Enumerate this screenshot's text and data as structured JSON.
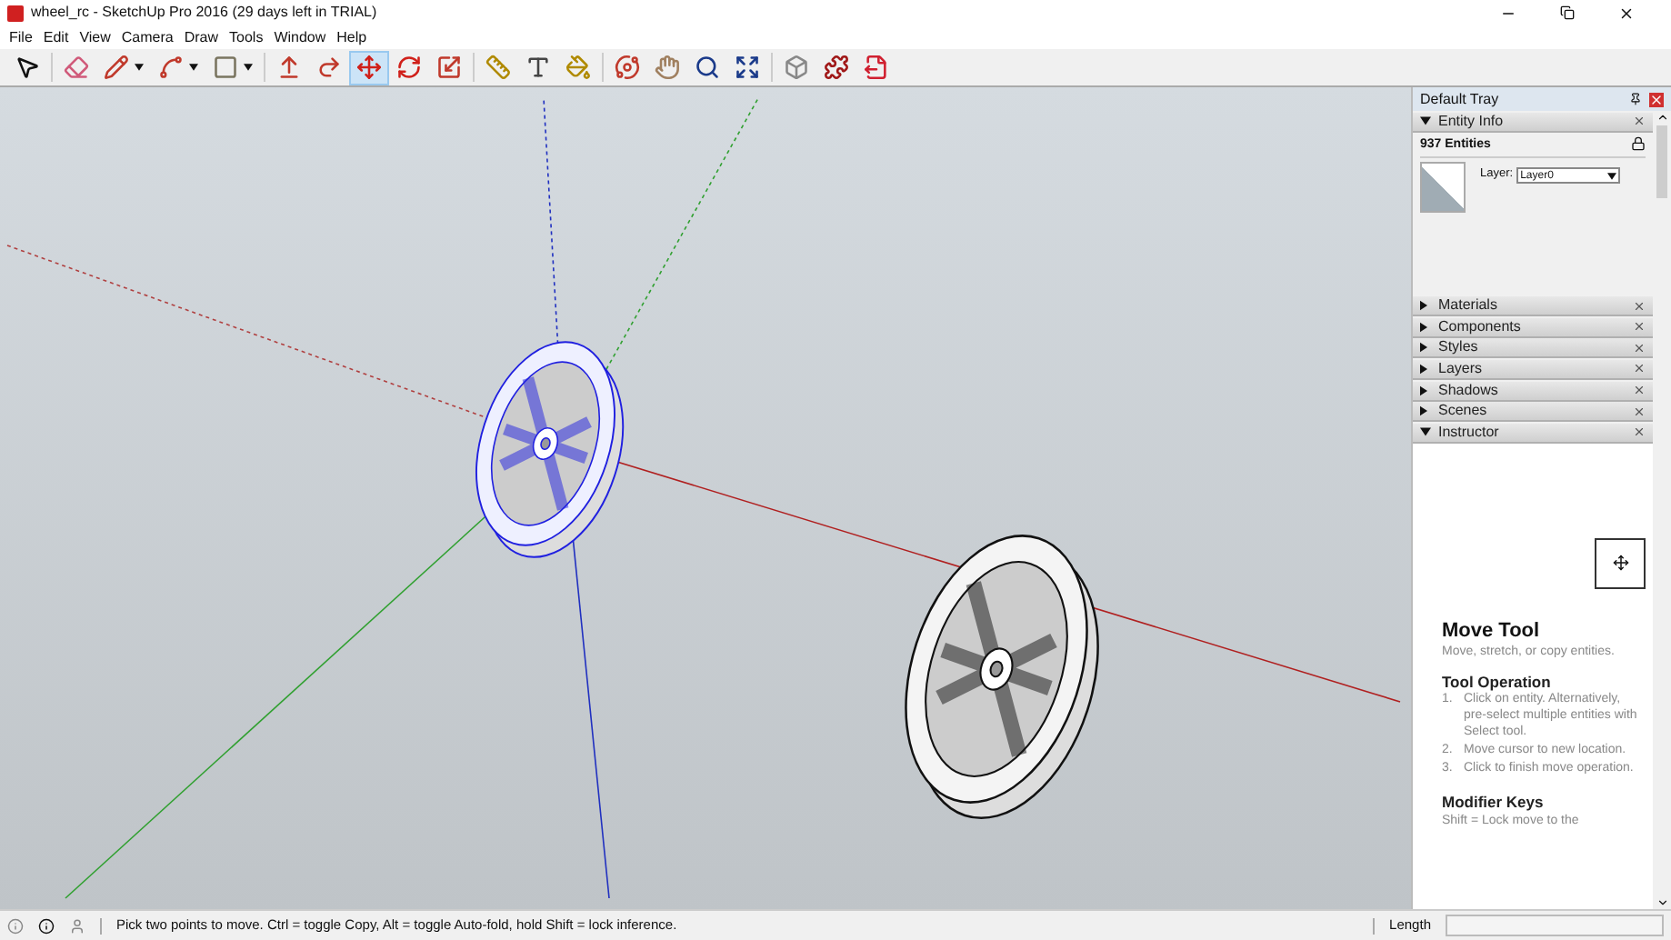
{
  "window": {
    "title": "wheel_rc - SketchUp Pro 2016 (29 days left in TRIAL)"
  },
  "menu": [
    "File",
    "Edit",
    "View",
    "Camera",
    "Draw",
    "Tools",
    "Window",
    "Help"
  ],
  "toolbar": [
    {
      "kind": "select",
      "selected": false
    },
    {
      "kind": "eraser",
      "selected": false
    },
    {
      "kind": "pencil",
      "selected": false,
      "dropdown": true
    },
    {
      "kind": "arc",
      "selected": false,
      "dropdown": true
    },
    {
      "kind": "rectangle",
      "selected": false,
      "dropdown": true
    },
    {
      "kind": "pushpull",
      "selected": false
    },
    {
      "kind": "followme",
      "selected": false
    },
    {
      "kind": "move",
      "selected": true
    },
    {
      "kind": "rotate",
      "selected": false
    },
    {
      "kind": "scale",
      "selected": false
    },
    {
      "kind": "tape",
      "selected": false
    },
    {
      "kind": "text",
      "selected": false
    },
    {
      "kind": "paint",
      "selected": false
    },
    {
      "kind": "orbit",
      "selected": false
    },
    {
      "kind": "pan",
      "selected": false
    },
    {
      "kind": "zoom",
      "selected": false
    },
    {
      "kind": "extents",
      "selected": false
    },
    {
      "kind": "warehouse",
      "selected": false
    },
    {
      "kind": "extension",
      "selected": false
    },
    {
      "kind": "export",
      "selected": false
    }
  ],
  "viewport": {
    "wheels": [
      {
        "selected": true
      },
      {
        "selected": false
      }
    ]
  },
  "tray": {
    "title": "Default Tray",
    "entity_info": {
      "title": "Entity Info",
      "expanded": true,
      "count": "937 Entities",
      "layer_label": "Layer:",
      "layer_value": "Layer0"
    },
    "panels": [
      {
        "title": "Materials",
        "expanded": false
      },
      {
        "title": "Components",
        "expanded": false
      },
      {
        "title": "Styles",
        "expanded": false
      },
      {
        "title": "Layers",
        "expanded": false
      },
      {
        "title": "Shadows",
        "expanded": false
      },
      {
        "title": "Scenes",
        "expanded": false
      },
      {
        "title": "Instructor",
        "expanded": true
      }
    ],
    "instructor": {
      "tool_name": "Move Tool",
      "description": "Move, stretch, or copy entities.",
      "operation_heading": "Tool Operation",
      "steps": [
        {
          "number": "1.",
          "text": "Click on entity. Alternatively, pre-select multiple entities with Select tool."
        },
        {
          "number": "2.",
          "text": "Move cursor to new location."
        },
        {
          "number": "3.",
          "text": "Click to finish move operation."
        }
      ],
      "modifier_heading": "Modifier Keys",
      "modifier_text": "Shift = Lock move to the"
    }
  },
  "status_bar": {
    "message": "Pick two points to move.  Ctrl = toggle Copy, Alt = toggle Auto-fold, hold Shift = lock inference.",
    "measure_label": "Length"
  }
}
